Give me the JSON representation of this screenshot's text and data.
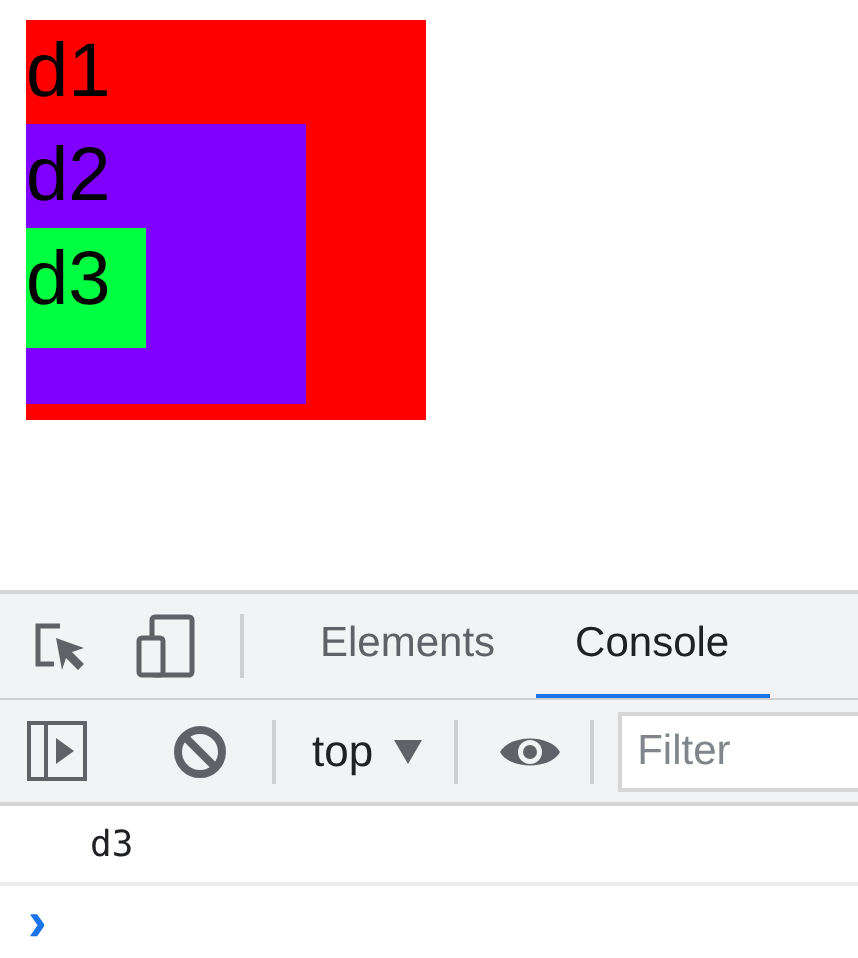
{
  "page": {
    "boxes": [
      {
        "label": "d1",
        "color": "#ff0000",
        "children": [
          {
            "label": "d2",
            "color": "#8000ff",
            "children": [
              {
                "label": "d3",
                "color": "#00ff40"
              }
            ]
          }
        ]
      }
    ]
  },
  "devtools": {
    "tabs": [
      {
        "label": "Elements",
        "selected": false
      },
      {
        "label": "Console",
        "selected": true
      }
    ],
    "toolbar": {
      "context": "top",
      "filter": {
        "placeholder": "Filter"
      }
    },
    "console": {
      "messages": [
        "d3"
      ],
      "prompt": "›"
    }
  }
}
